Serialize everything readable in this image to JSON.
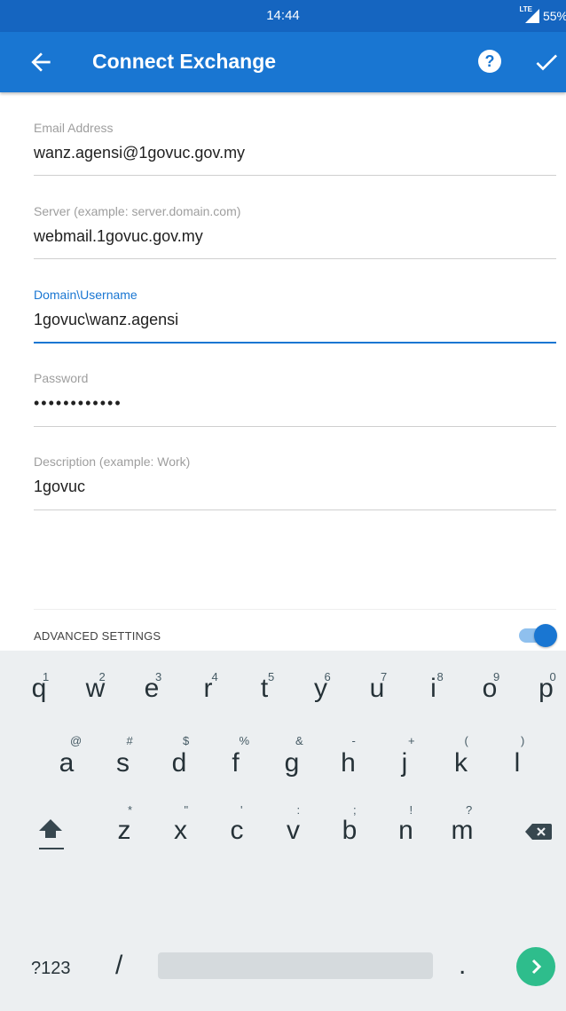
{
  "status_bar": {
    "time": "14:44",
    "network": "LTE",
    "battery": "55%"
  },
  "app_bar": {
    "title": "Connect Exchange"
  },
  "form": {
    "email": {
      "label": "Email Address",
      "value": "wanz.agensi@1govuc.gov.my"
    },
    "server": {
      "label": "Server (example: server.domain.com)",
      "value": "webmail.1govuc.gov.my"
    },
    "username": {
      "label": "Domain\\Username",
      "value": "1govuc\\wanz.agensi"
    },
    "password": {
      "label": "Password",
      "value": "••••••••••••"
    },
    "description": {
      "label": "Description (example: Work)",
      "value": "1govuc"
    },
    "advanced": {
      "label": "ADVANCED SETTINGS",
      "enabled": true
    }
  },
  "colors": {
    "accent": "#1976d2",
    "status_bar": "#1565c0",
    "enter_key": "#2ebd8c"
  },
  "keyboard": {
    "row1": [
      {
        "k": "q",
        "h": "1"
      },
      {
        "k": "w",
        "h": "2"
      },
      {
        "k": "e",
        "h": "3"
      },
      {
        "k": "r",
        "h": "4"
      },
      {
        "k": "t",
        "h": "5"
      },
      {
        "k": "y",
        "h": "6"
      },
      {
        "k": "u",
        "h": "7"
      },
      {
        "k": "i",
        "h": "8"
      },
      {
        "k": "o",
        "h": "9"
      },
      {
        "k": "p",
        "h": "0"
      }
    ],
    "row2": [
      {
        "k": "a",
        "h": "@"
      },
      {
        "k": "s",
        "h": "#"
      },
      {
        "k": "d",
        "h": "$"
      },
      {
        "k": "f",
        "h": "%"
      },
      {
        "k": "g",
        "h": "&"
      },
      {
        "k": "h",
        "h": "-"
      },
      {
        "k": "j",
        "h": "+"
      },
      {
        "k": "k",
        "h": "("
      },
      {
        "k": "l",
        "h": ")"
      }
    ],
    "row3": [
      {
        "k": "z",
        "h": "*"
      },
      {
        "k": "x",
        "h": "\""
      },
      {
        "k": "c",
        "h": "'"
      },
      {
        "k": "v",
        "h": ":"
      },
      {
        "k": "b",
        "h": ";"
      },
      {
        "k": "n",
        "h": "!"
      },
      {
        "k": "m",
        "h": "?"
      }
    ],
    "sym_label": "?123",
    "slash": "/",
    "period": "."
  }
}
